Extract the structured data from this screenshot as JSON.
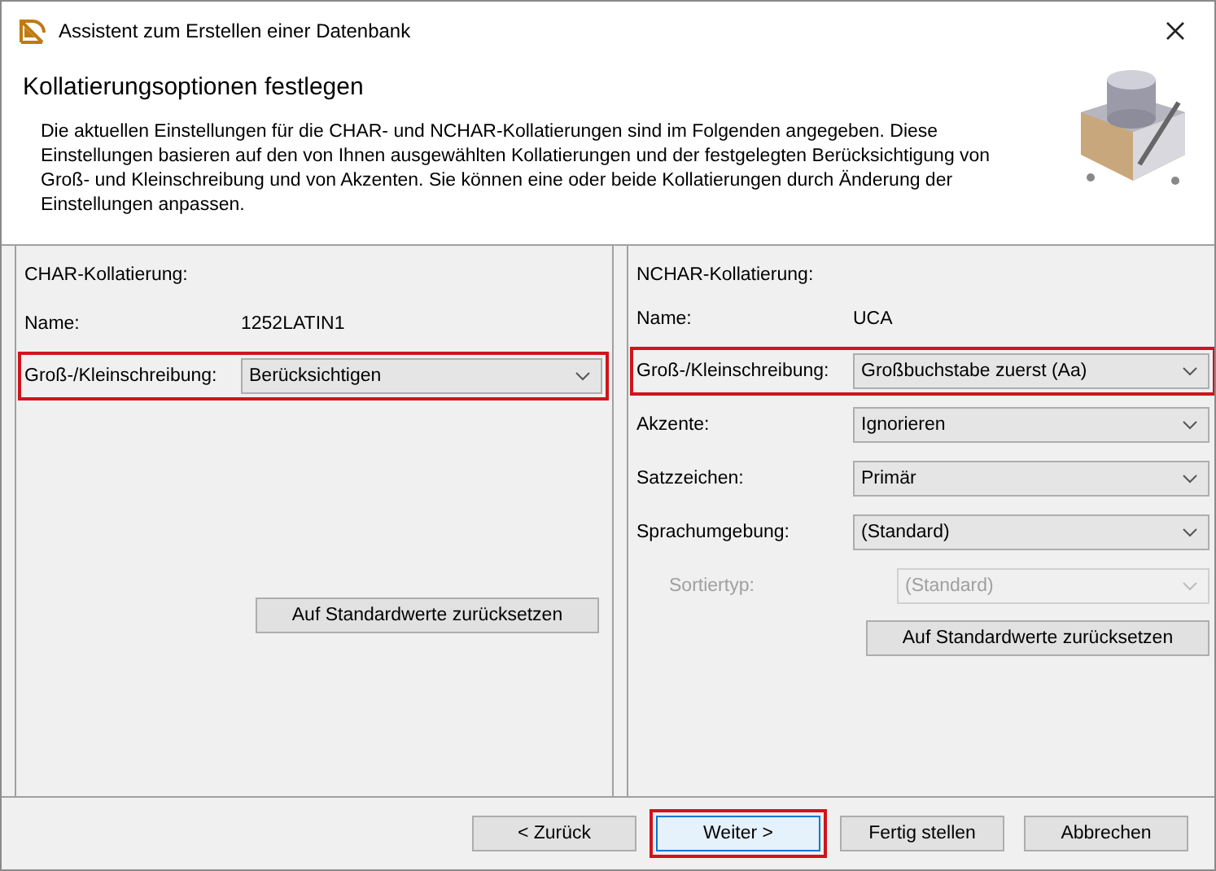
{
  "window": {
    "title": "Assistent zum Erstellen einer Datenbank"
  },
  "header": {
    "title": "Kollatierungsoptionen festlegen",
    "description": "Die aktuellen Einstellungen für die CHAR- und NCHAR-Kollatierungen sind im Folgenden angegeben. Diese Einstellungen basieren auf den von Ihnen ausgewählten Kollatierungen und der festgelegten Berücksichtigung von Groß- und Kleinschreibung und von Akzenten. Sie können eine oder beide Kollatierungen durch Änderung der Einstellungen anpassen."
  },
  "panels": [
    {
      "title": "CHAR-Kollatierung:",
      "name_label": "Name:",
      "name_value": "1252LATIN1",
      "fields": [
        {
          "label": "Groß-/Kleinschreibung:",
          "value": "Berücksichtigen",
          "highlighted": true,
          "disabled": false
        }
      ],
      "reset_button": "Auf Standardwerte zurücksetzen"
    },
    {
      "title": "NCHAR-Kollatierung:",
      "name_label": "Name:",
      "name_value": "UCA",
      "fields": [
        {
          "label": "Groß-/Kleinschreibung:",
          "value": "Großbuchstabe zuerst (Aa)",
          "highlighted": true,
          "disabled": false
        },
        {
          "label": "Akzente:",
          "value": "Ignorieren",
          "highlighted": false,
          "disabled": false
        },
        {
          "label": "Satzzeichen:",
          "value": "Primär",
          "highlighted": false,
          "disabled": false
        },
        {
          "label": "Sprachumgebung:",
          "value": "(Standard)",
          "highlighted": false,
          "disabled": false
        },
        {
          "label": "Sortiertyp:",
          "value": "(Standard)",
          "highlighted": false,
          "disabled": true
        }
      ],
      "reset_button": "Auf Standardwerte zurücksetzen"
    }
  ],
  "buttons": [
    {
      "label": "< Zurück",
      "highlighted": false
    },
    {
      "label": "Weiter >",
      "highlighted": true
    },
    {
      "label": "Fertig stellen",
      "highlighted": false
    },
    {
      "label": "Abbrechen",
      "highlighted": false
    }
  ]
}
